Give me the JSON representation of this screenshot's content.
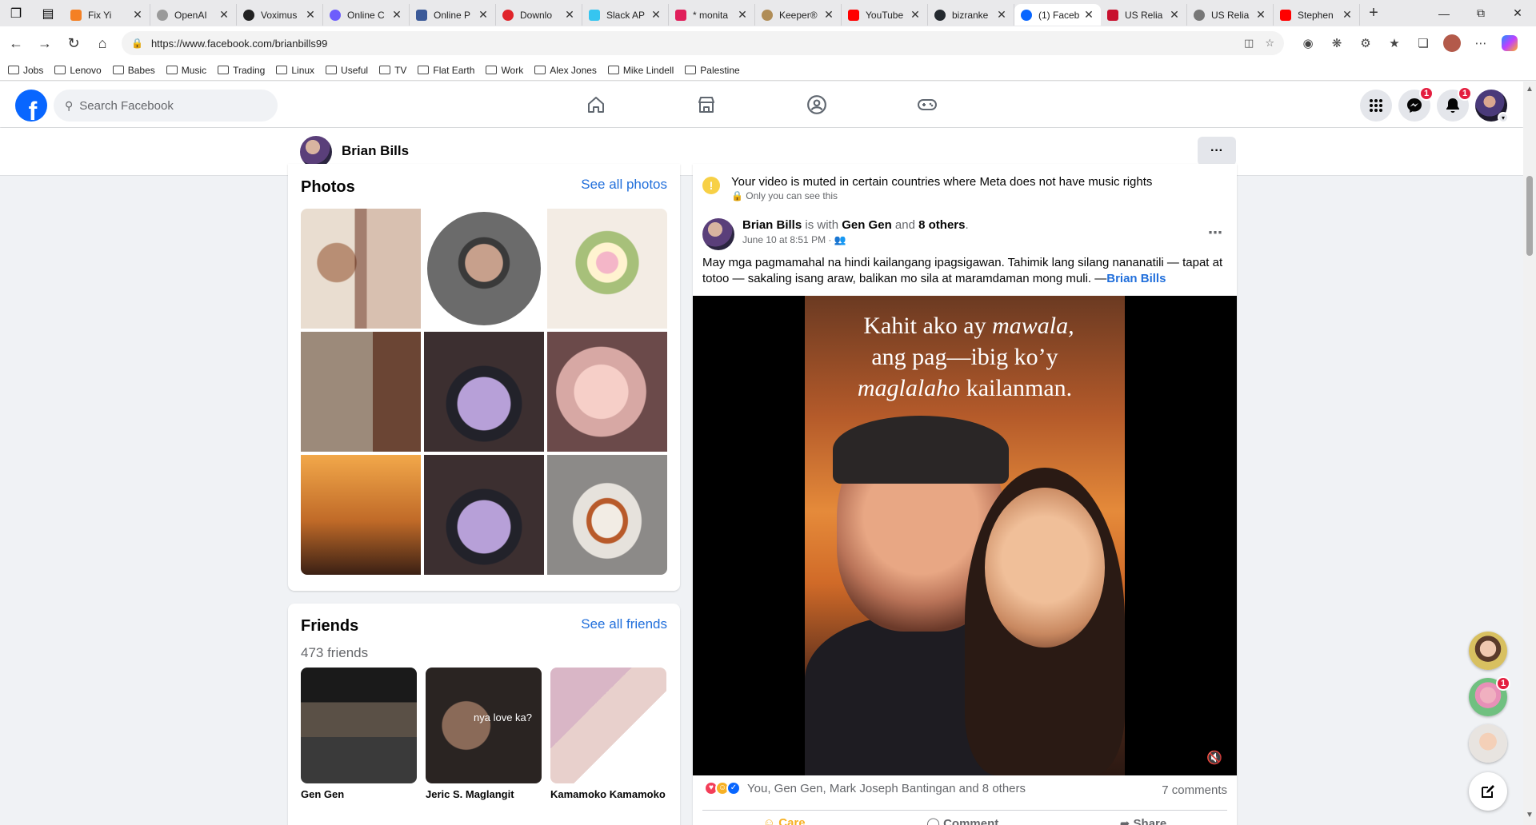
{
  "browser": {
    "tabs": [
      {
        "title": "Fix Yi",
        "color": "#f48024"
      },
      {
        "title": "OpenAI",
        "color": "#9a9a9a"
      },
      {
        "title": "Voximus",
        "color": "#222222"
      },
      {
        "title": "Online C",
        "color": "#6d5dfc"
      },
      {
        "title": "Online P",
        "color": "#3b5998"
      },
      {
        "title": "Downlo",
        "color": "#e0242a"
      },
      {
        "title": "Slack AP",
        "color": "#36c5f0"
      },
      {
        "title": "* monita",
        "color": "#e01e5a"
      },
      {
        "title": "Keeper®",
        "color": "#b08d57"
      },
      {
        "title": "YouTube",
        "color": "#ff0000"
      },
      {
        "title": "bizranke",
        "color": "#24292f"
      },
      {
        "title": "(1) Faceb",
        "color": "#0866ff",
        "active": true
      },
      {
        "title": "US Relia",
        "color": "#c8102e"
      },
      {
        "title": "US Relia",
        "color": "#777777"
      },
      {
        "title": "Stephen",
        "color": "#ff0000"
      }
    ],
    "url": "https://www.facebook.com/brianbills99",
    "bookmarks": [
      "Jobs",
      "Lenovo",
      "Babes",
      "Music",
      "Trading",
      "Linux",
      "Useful",
      "TV",
      "Flat Earth",
      "Work",
      "Alex Jones",
      "Mike Lindell",
      "Palestine"
    ]
  },
  "facebook": {
    "search_placeholder": "Search Facebook",
    "nav_icons": [
      "home-icon",
      "marketplace-icon",
      "groups-icon",
      "gaming-icon"
    ],
    "messenger_badge": "1",
    "notifications_badge": "1",
    "accent": "#0866ff"
  },
  "profile": {
    "name": "Brian Bills",
    "more_label": "···"
  },
  "photos": {
    "title": "Photos",
    "see_all": "See all photos"
  },
  "friends": {
    "title": "Friends",
    "see_all": "See all friends",
    "count": "473 friends",
    "list": [
      {
        "name": "Gen Gen"
      },
      {
        "name": "Jeric S. Maglangit",
        "overlay": "nya love ka?"
      },
      {
        "name": "Kamamoko Kamamoko"
      }
    ]
  },
  "post": {
    "muted_notice": "Your video is muted in certain countries where Meta does not have music rights",
    "muted_sub": "Only you can see this",
    "author": "Brian Bills",
    "with_text": "is with",
    "tagged": "Gen Gen",
    "and_text": "and",
    "others": "8 others",
    "time": "June 10 at 8:51 PM",
    "body": "May mga pagmamahal na hindi kailangang ipagsigawan. Tahimik lang silang nananatili — tapat at totoo — sakaling isang araw, balikan mo sila at maramdaman mong muli. —",
    "body_tag": "Brian Bills",
    "video_line1_a": "Kahit ako ay ",
    "video_line1_b": "mawala,",
    "video_line2": "ang pag—ibig ko’y",
    "video_line3_a": "maglalaho",
    "video_line3_b": " kailanman.",
    "reactions_text": "You, Gen Gen, Mark Joseph Bantingan and 8 others",
    "comments": "7 comments",
    "actions": [
      "Care",
      "Comment",
      "Share"
    ]
  },
  "contacts_badge": "1"
}
